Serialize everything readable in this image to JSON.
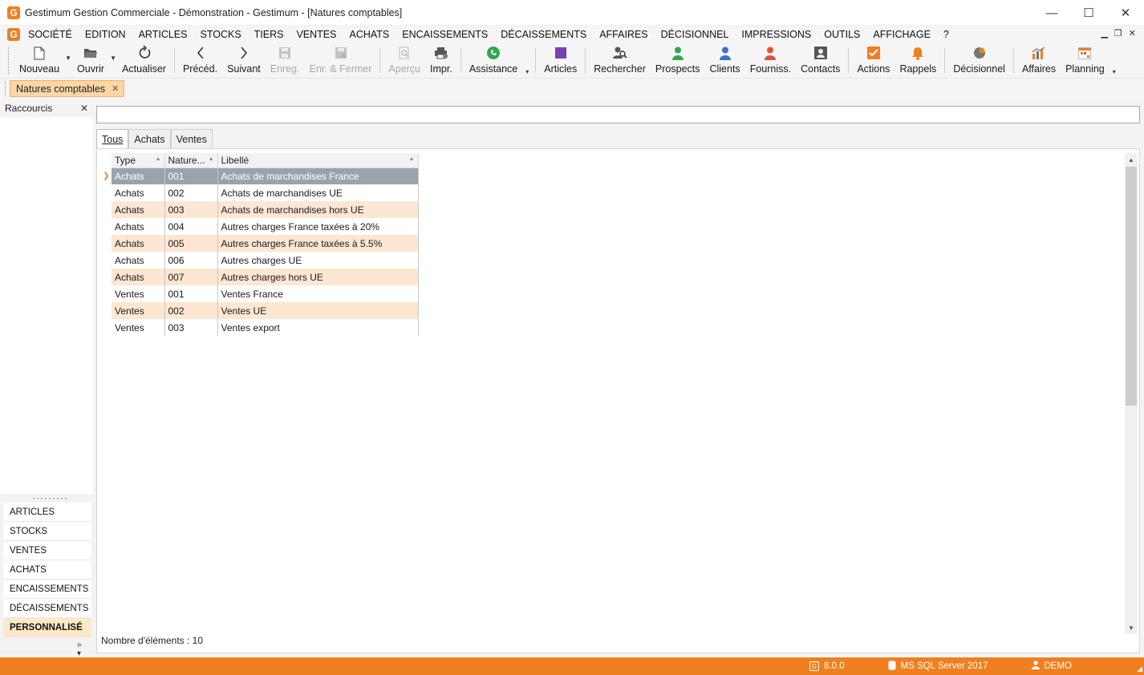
{
  "window": {
    "title": "Gestimum Gestion Commerciale - Démonstration - Gestimum - [Natures comptables]",
    "logo_letter": "G",
    "minimize_glyph": "—",
    "maximize_glyph": "☐",
    "close_glyph": "✕"
  },
  "menu": {
    "items": [
      "SOCIÉTÉ",
      "EDITION",
      "ARTICLES",
      "STOCKS",
      "TIERS",
      "VENTES",
      "ACHATS",
      "ENCAISSEMENTS",
      "DÉCAISSEMENTS",
      "AFFAIRES",
      "DÉCISIONNEL",
      "IMPRESSIONS",
      "OUTILS",
      "AFFICHAGE",
      "?"
    ]
  },
  "toolbar": {
    "nouveau": "Nouveau",
    "ouvrir": "Ouvrir",
    "actualiser": "Actualiser",
    "preced": "Précéd.",
    "suivant": "Suivant",
    "enreg": "Enreg.",
    "enr_fermer": "Enr. & Fermer",
    "apercu": "Aperçu",
    "impr": "Impr.",
    "assistance": "Assistance",
    "articles": "Articles",
    "rechercher": "Rechercher",
    "prospects": "Prospects",
    "clients": "Clients",
    "fourniss": "Fourniss.",
    "contacts": "Contacts",
    "actions": "Actions",
    "rappels": "Rappels",
    "decisionnel": "Décisionnel",
    "affaires": "Affaires",
    "planning": "Planning"
  },
  "doc_tab": {
    "label": "Natures comptables"
  },
  "shortcuts": {
    "title": "Raccourcis",
    "groups": [
      "ARTICLES",
      "STOCKS",
      "VENTES",
      "ACHATS",
      "ENCAISSEMENTS",
      "DÉCAISSEMENTS",
      "PERSONNALISÉ"
    ],
    "active_group": "PERSONNALISÉ"
  },
  "search": {
    "value": ""
  },
  "tabs": [
    "Tous",
    "Achats",
    "Ventes"
  ],
  "active_tab": "Tous",
  "grid": {
    "columns": [
      "Type",
      "Nature...",
      "Libellé"
    ],
    "rows": [
      {
        "type": "Achats",
        "nature": "001",
        "libelle": "Achats de marchandises France",
        "selected": true
      },
      {
        "type": "Achats",
        "nature": "002",
        "libelle": "Achats de marchandises UE"
      },
      {
        "type": "Achats",
        "nature": "003",
        "libelle": "Achats de marchandises hors UE"
      },
      {
        "type": "Achats",
        "nature": "004",
        "libelle": "Autres charges France taxées à 20%"
      },
      {
        "type": "Achats",
        "nature": "005",
        "libelle": "Autres charges France taxées à 5.5%"
      },
      {
        "type": "Achats",
        "nature": "006",
        "libelle": "Autres charges UE"
      },
      {
        "type": "Achats",
        "nature": "007",
        "libelle": "Autres charges hors UE"
      },
      {
        "type": "Ventes",
        "nature": "001",
        "libelle": "Ventes France"
      },
      {
        "type": "Ventes",
        "nature": "002",
        "libelle": "Ventes UE"
      },
      {
        "type": "Ventes",
        "nature": "003",
        "libelle": "Ventes export"
      }
    ]
  },
  "footer": {
    "count_label": "Nombre d'éléments : 10"
  },
  "status": {
    "version": "8.0.0",
    "server": "MS SQL Server 2017",
    "user": "DEMO"
  },
  "colors": {
    "accent": "#f07f1f",
    "selection": "#9ba2ad",
    "row_alt": "#fde6d2",
    "doc_tab": "#fbd7a6"
  }
}
